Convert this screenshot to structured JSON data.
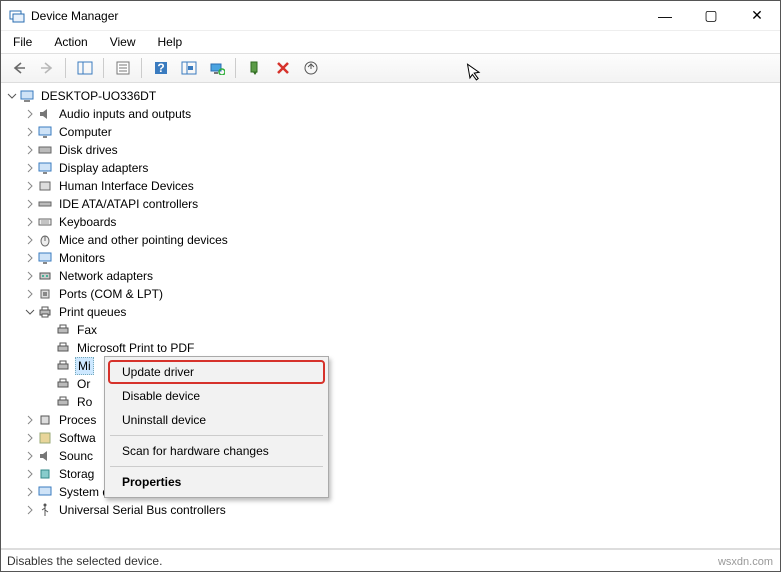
{
  "window": {
    "title": "Device Manager",
    "min": "—",
    "max": "▢",
    "close": "✕"
  },
  "menubar": [
    "File",
    "Action",
    "View",
    "Help"
  ],
  "root": {
    "name": "DESKTOP-UO336DT",
    "items": [
      {
        "label": "Audio inputs and outputs",
        "icon": "audio"
      },
      {
        "label": "Computer",
        "icon": "monitor"
      },
      {
        "label": "Disk drives",
        "icon": "disk"
      },
      {
        "label": "Display adapters",
        "icon": "monitor"
      },
      {
        "label": "Human Interface Devices",
        "icon": "hid"
      },
      {
        "label": "IDE ATA/ATAPI controllers",
        "icon": "ide"
      },
      {
        "label": "Keyboards",
        "icon": "keyboard"
      },
      {
        "label": "Mice and other pointing devices",
        "icon": "mouse"
      },
      {
        "label": "Monitors",
        "icon": "monitor"
      },
      {
        "label": "Network adapters",
        "icon": "net"
      },
      {
        "label": "Ports (COM & LPT)",
        "icon": "port"
      }
    ]
  },
  "printqueues": {
    "label": "Print queues",
    "children": [
      {
        "label": "Fax"
      },
      {
        "label": "Microsoft Print to PDF"
      },
      {
        "label": "Mi"
      },
      {
        "label": "Or"
      },
      {
        "label": "Ro"
      }
    ]
  },
  "after": [
    {
      "label": "Proces"
    },
    {
      "label": "Softwa"
    },
    {
      "label": "Sounc"
    },
    {
      "label": "Storag"
    },
    {
      "label": "System devices"
    },
    {
      "label": "Universal Serial Bus controllers"
    }
  ],
  "context": {
    "update": "Update driver",
    "disable": "Disable device",
    "uninstall": "Uninstall device",
    "scan": "Scan for hardware changes",
    "props": "Properties"
  },
  "statusbar": "Disables the selected device.",
  "watermark": "wsxdn.com"
}
